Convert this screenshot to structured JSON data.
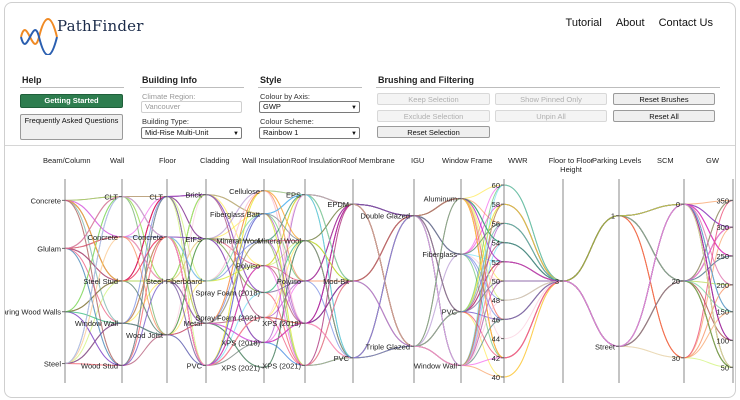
{
  "app": {
    "name": "PathFinder"
  },
  "nav": [
    "Tutorial",
    "About",
    "Contact Us"
  ],
  "help": {
    "title": "Help",
    "getting_started": "Getting Started",
    "faq": "Frequently Asked Questions"
  },
  "building_info": {
    "title": "Building Info",
    "climate_label": "Climate Region:",
    "climate_value": "Vancouver",
    "type_label": "Building Type:",
    "type_value": "Mid-Rise Multi-Unit"
  },
  "style": {
    "title": "Style",
    "colour_axis_label": "Colour by Axis:",
    "colour_axis_value": "GWP",
    "scheme_label": "Colour Scheme:",
    "scheme_value": "Rainbow 1"
  },
  "brushing": {
    "title": "Brushing and Filtering",
    "keep": "Keep Selection",
    "show_pinned": "Show Pinned Only",
    "reset_brushes": "Reset Brushes",
    "exclude": "Exclude Selection",
    "unpin": "Unpin All",
    "reset_all": "Reset All",
    "reset_selection": "Reset Selection"
  },
  "axes": [
    {
      "name": "Beam/Column",
      "ticks": [
        "Concrete",
        "Glulam",
        "Load Bearing Wood Walls",
        "Steel"
      ]
    },
    {
      "name": "Wall",
      "ticks": [
        "CLT",
        "Concrete",
        "Steel Stud",
        "Window Wall",
        "Wood Stud"
      ]
    },
    {
      "name": "Floor",
      "ticks": [
        "CLT",
        "Concrete",
        "Steel",
        "Wood Joist"
      ]
    },
    {
      "name": "Cladding",
      "ticks": [
        "Brick",
        "EIFS",
        "Fiberboard",
        "Metal",
        "PVC"
      ]
    },
    {
      "name": "Wall Insulation",
      "ticks": [
        "Cellulose",
        "Fiberglass Batt",
        "Mineral Wool",
        "Polyiso",
        "Spray Foam (2018)",
        "Spray Foam (2021)",
        "XPS (2018)",
        "XPS (2021)"
      ]
    },
    {
      "name": "Roof Insulation",
      "ticks": [
        "EPS",
        "Mineral Wool",
        "Polyiso",
        "XPS (2018)",
        "XPS (2021)"
      ]
    },
    {
      "name": "Roof Membrane",
      "ticks": [
        "EPDM",
        "Mod-Bit",
        "PVC"
      ]
    },
    {
      "name": "IGU",
      "ticks": [
        "Double Glazed",
        "Triple Glazed"
      ]
    },
    {
      "name": "Window Frame",
      "ticks": [
        "Aluminum",
        "Fiberglass",
        "PVC",
        "Window Wall"
      ]
    },
    {
      "name": "WWR",
      "ticks": [
        "60",
        "58",
        "56",
        "54",
        "52",
        "50",
        "48",
        "46",
        "44",
        "42",
        "40"
      ]
    },
    {
      "name": "Floor to Floor Height",
      "ticks": [
        "3"
      ]
    },
    {
      "name": "Parking Levels",
      "ticks": [
        "1",
        "Street"
      ]
    },
    {
      "name": "SCM",
      "ticks": [
        "0",
        "20",
        "30"
      ]
    },
    {
      "name": "GW",
      "ticks": [
        "350",
        "300",
        "250",
        "200",
        "150",
        "100",
        "50"
      ]
    }
  ],
  "colors": {
    "accent_green": "#2e7d4f",
    "logo_orange": "#f08a24",
    "logo_blue": "#2b5fb0"
  }
}
